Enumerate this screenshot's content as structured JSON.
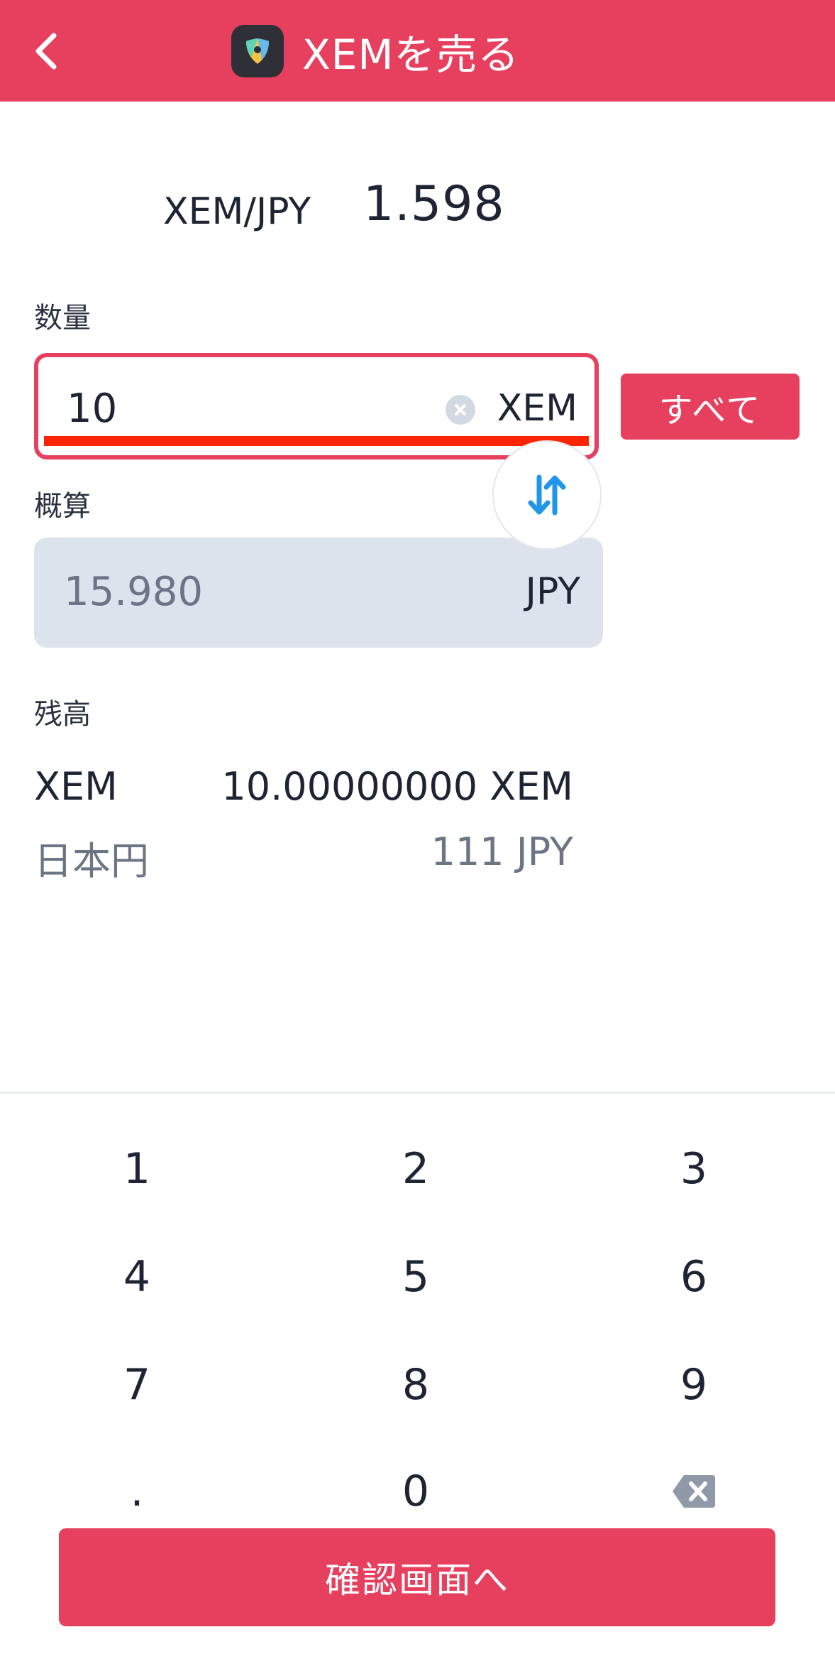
{
  "colors": {
    "accent": "#e6405e",
    "underline": "#ff2400",
    "swap_arrows": "#2196e8",
    "approx_bg": "#dde3ec"
  },
  "header": {
    "title": "XEMを売る",
    "back_icon": "chevron-left-icon",
    "coin_icon": "nem-logo-icon"
  },
  "rate": {
    "pair": "XEM/JPY",
    "value": "1.598"
  },
  "quantity": {
    "label": "数量",
    "value": "10",
    "unit": "XEM",
    "all_button": "すべて",
    "clear_icon": "clear-icon"
  },
  "estimate": {
    "label": "概算",
    "value": "15.980",
    "unit": "JPY",
    "swap_icon": "swap-arrows-icon"
  },
  "balance": {
    "label": "残高",
    "rows": [
      {
        "name": "XEM",
        "amount": "10.00000000 XEM"
      },
      {
        "name": "日本円",
        "amount": "111 JPY"
      }
    ]
  },
  "keypad": [
    "1",
    "2",
    "3",
    "4",
    "5",
    "6",
    "7",
    "8",
    "9",
    ".",
    "0",
    "backspace"
  ],
  "confirm_button": "確認画面へ"
}
